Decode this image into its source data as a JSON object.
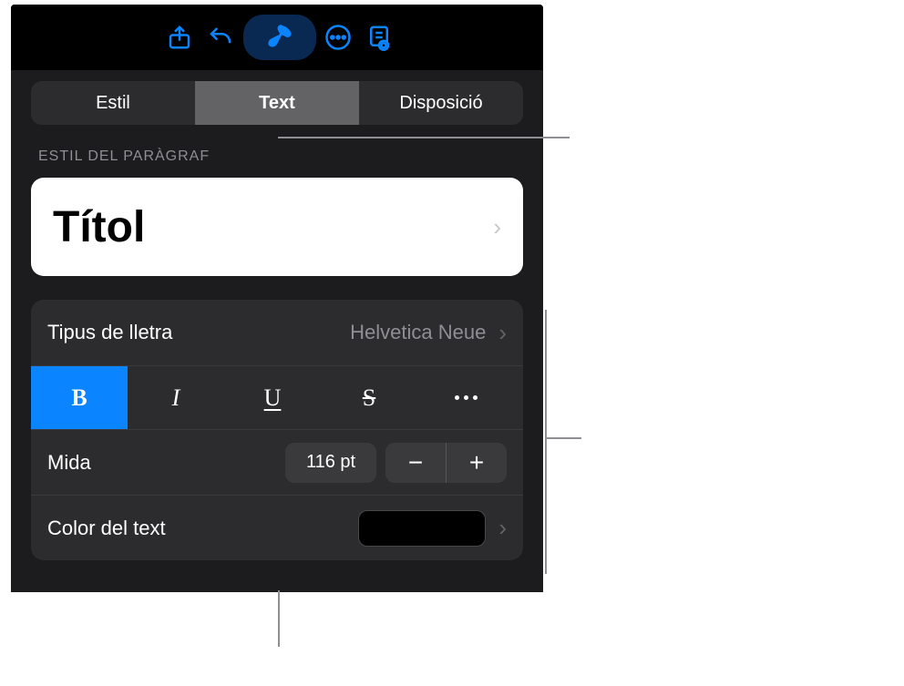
{
  "tabs": {
    "style": "Estil",
    "text": "Text",
    "layout": "Disposició"
  },
  "section": {
    "paragraph_style_label": "ESTIL DEL PARÀGRAF"
  },
  "paragraph_style": {
    "name": "Títol"
  },
  "font": {
    "label": "Tipus de lletra",
    "value": "Helvetica Neue"
  },
  "format": {
    "bold": "B",
    "italic": "I",
    "underline": "U",
    "strike": "S"
  },
  "size": {
    "label": "Mida",
    "value": "116 pt",
    "minus": "−",
    "plus": "+"
  },
  "text_color": {
    "label": "Color del text",
    "value": "#000000"
  }
}
